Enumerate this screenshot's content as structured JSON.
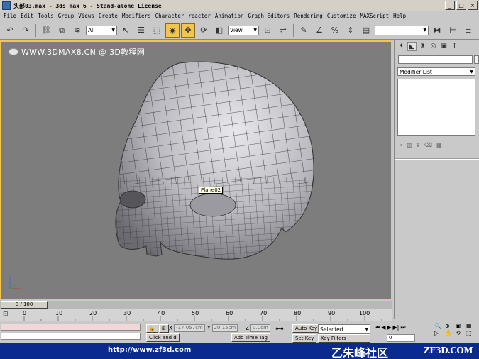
{
  "window": {
    "title": "头部03.max - 3ds max 6 - Stand-alone License",
    "buttons": [
      "_",
      "□",
      "×"
    ]
  },
  "menu": [
    "File",
    "Edit",
    "Tools",
    "Group",
    "Views",
    "Create",
    "Modifiers",
    "Character",
    "reactor",
    "Animation",
    "Graph Editors",
    "Rendering",
    "Customize",
    "MAXScript",
    "Help"
  ],
  "toolbar": {
    "selection_filter": "All",
    "reference_coord": "View",
    "named_selection": ""
  },
  "viewport": {
    "watermark_text": "WWW.3DMAX8.CN @ 3D教程网",
    "object_label": "Plane02",
    "colors": {
      "background": "#7d7d7d",
      "active_border": "#f2c64a",
      "mesh_fill": "#c8c8cc",
      "wire": "#2a2a2a"
    }
  },
  "command_panel": {
    "modifier_list": "Modifier List",
    "object_name": ""
  },
  "timeline": {
    "frame_display": "0 / 100",
    "ticks": [
      "0",
      "10",
      "20",
      "30",
      "40",
      "50",
      "60",
      "70",
      "80",
      "90",
      "100"
    ]
  },
  "status": {
    "x_label": "X",
    "x_value": "-17.057cm",
    "y_label": "Y",
    "y_value": "20.15cm",
    "z_label": "Z",
    "z_value": "0.0cm",
    "autokey_label": "Auto Key",
    "setkey_label": "Set Key",
    "selected_option": "Selected",
    "keyfilters_label": "Key Filters",
    "frame_field": "0",
    "prompt_text": "Click and d",
    "add_time_tag": "Add Time Tag"
  },
  "watermark": {
    "url": "http://www.zf3d.com",
    "community": "乙朱峰社区",
    "site": "ZF3D.COM"
  }
}
